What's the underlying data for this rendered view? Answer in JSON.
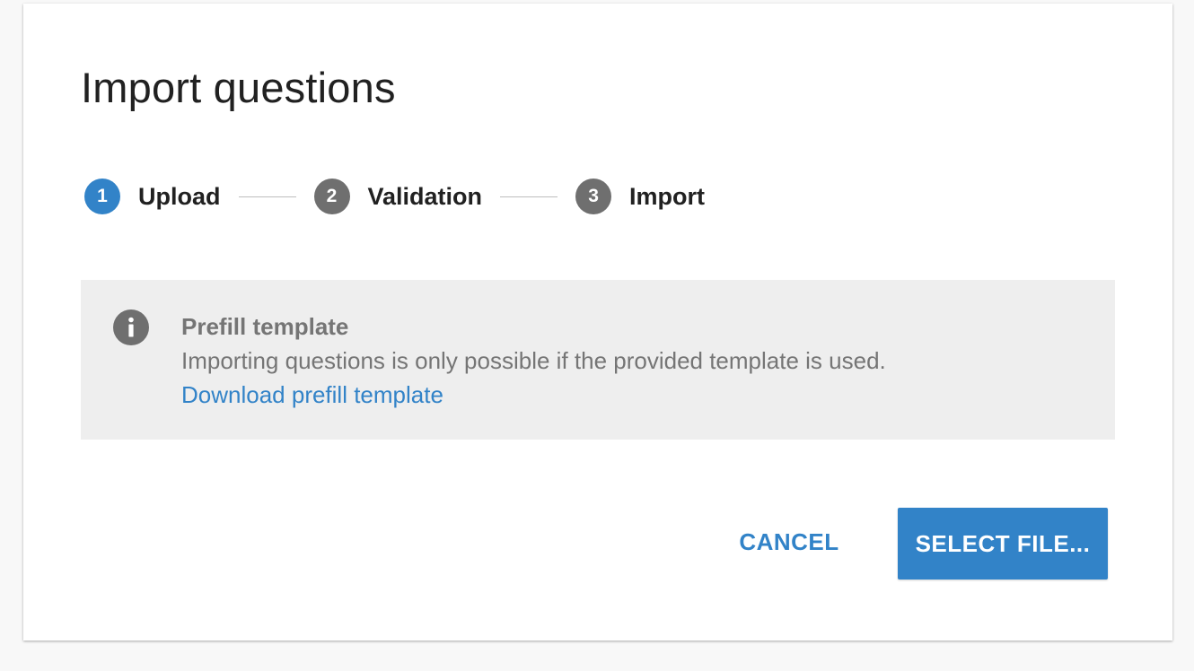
{
  "dialog": {
    "title": "Import questions"
  },
  "stepper": {
    "steps": [
      {
        "number": "1",
        "label": "Upload",
        "state": "active"
      },
      {
        "number": "2",
        "label": "Validation",
        "state": "inactive"
      },
      {
        "number": "3",
        "label": "Import",
        "state": "inactive"
      }
    ]
  },
  "info": {
    "icon": "info-icon",
    "heading": "Prefill template",
    "body": "Importing questions is only possible if the provided template is used.",
    "link": "Download prefill template"
  },
  "actions": {
    "cancel_label": "CANCEL",
    "select_label": "SELECT FILE..."
  },
  "colors": {
    "primary": "#3283c8",
    "inactive_step": "#6f6f6f",
    "info_icon": "#6f6f6f"
  }
}
